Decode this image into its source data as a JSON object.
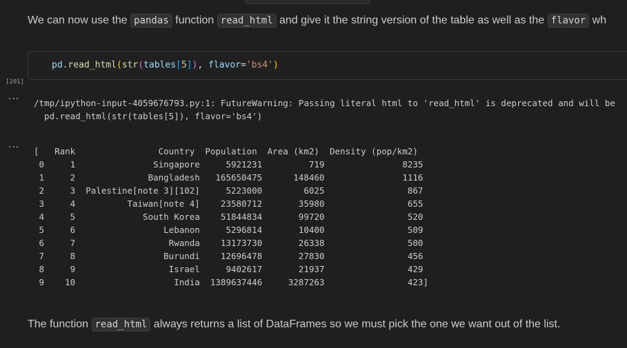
{
  "markdown_intro": {
    "text_1": "We can now use the ",
    "code_1": "pandas",
    "text_2": " function ",
    "code_2": "read_html",
    "text_3": " and give it the string version of the table as well as the ",
    "code_3": "flavor",
    "text_4": " wh"
  },
  "code_cell": {
    "execution_count": "[201]",
    "tokens": {
      "t1": "pd",
      "t2": ".",
      "t3": "read_html",
      "t4": "(",
      "t5": "str",
      "t6": "(",
      "t7": "tables",
      "t8": "[",
      "t9": "5",
      "t10": "]",
      "t11": ")",
      "t12": ", ",
      "t13": "flavor",
      "t14": "=",
      "t15": "'bs4'",
      "t16": ")"
    }
  },
  "output_warning": {
    "collapse_glyph": "···",
    "text": "/tmp/ipython-input-4059676793.py:1: FutureWarning: Passing literal html to 'read_html' is deprecated and will be\n  pd.read_html(str(tables[5]), flavor='bs4')"
  },
  "output_result": {
    "collapse_glyph": "···",
    "text": "[   Rank                Country  Population  Area (km2)  Density (pop/km2)\n 0     1               Singapore     5921231         719               8235\n 1     2              Bangladesh   165650475      148460               1116\n 2     3  Palestine[note 3][102]     5223000        6025                867\n 3     4          Taiwan[note 4]    23580712       35980                655\n 4     5             South Korea    51844834       99720                520\n 5     6                 Lebanon     5296814       10400                509\n 6     7                  Rwanda    13173730       26338                500\n 7     8                 Burundi    12696478       27830                456\n 8     9                  Israel     9402617       21937                429\n 9    10                   India  1389637446     3287263                423]"
  },
  "markdown_outro": {
    "text_1": "The function ",
    "code_1": "read_html",
    "text_2": " always returns a list of DataFrames so we must pick the one we want out of the list."
  }
}
